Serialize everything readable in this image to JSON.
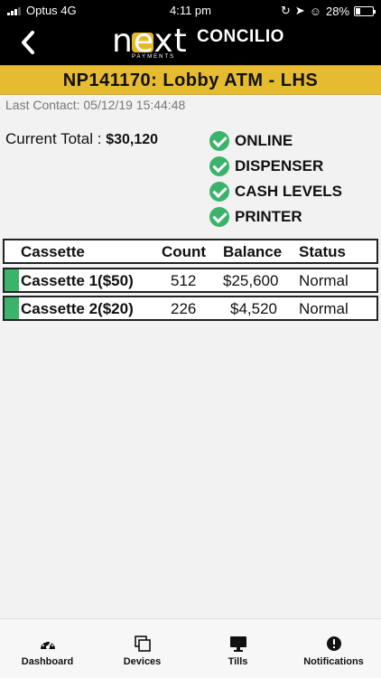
{
  "statusbar": {
    "carrier": "Optus 4G",
    "time": "4:11 pm",
    "battery": "28%",
    "battery_level": 0.28
  },
  "header": {
    "brand_logo": "next",
    "brand_logo_sub": "PAYMENTS",
    "brand_name": "CONCILIO"
  },
  "device": {
    "title": "NP141170: Lobby ATM - LHS"
  },
  "info": {
    "last_contact_label": "Last Contact:",
    "last_contact_value": "05/12/19 15:44:48",
    "total_label": "Current Total :",
    "total_value": "$30,120"
  },
  "statuses": [
    {
      "label": "ONLINE"
    },
    {
      "label": "DISPENSER"
    },
    {
      "label": "CASH LEVELS"
    },
    {
      "label": "PRINTER"
    }
  ],
  "table": {
    "headers": [
      "Cassette",
      "Count",
      "Balance",
      "Status"
    ],
    "rows": [
      {
        "name": "Cassette 1($50)",
        "count": "512",
        "balance": "$25,600",
        "status": "Normal"
      },
      {
        "name": "Cassette 2($20)",
        "count": "226",
        "balance": "$4,520",
        "status": "Normal"
      }
    ]
  },
  "nav": [
    {
      "label": "Dashboard",
      "icon": "speedometer-icon"
    },
    {
      "label": "Devices",
      "icon": "devices-icon"
    },
    {
      "label": "Tills",
      "icon": "monitor-icon"
    },
    {
      "label": "Notifications",
      "icon": "alert-icon"
    }
  ],
  "colors": {
    "accent": "#e7bb2f",
    "ok": "#3bb36a",
    "header_bg": "#000000"
  }
}
